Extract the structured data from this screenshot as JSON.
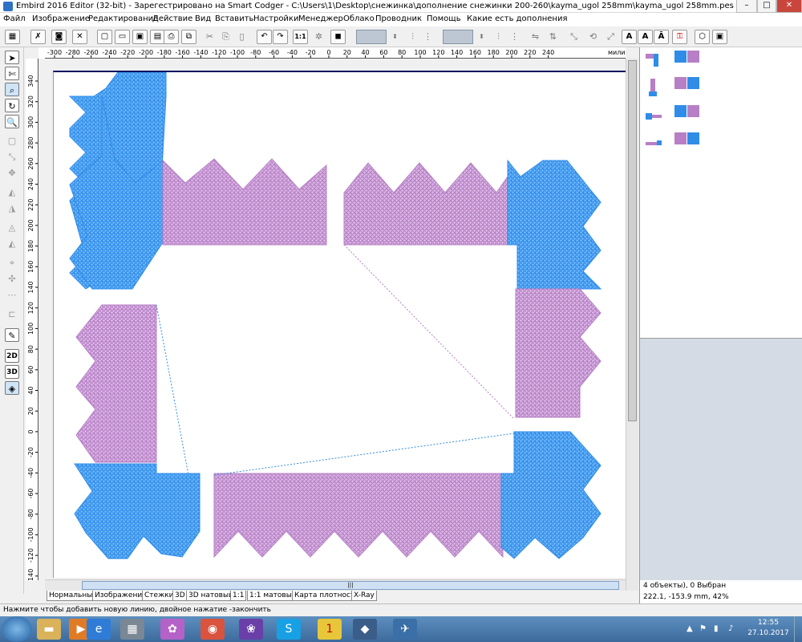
{
  "title": "Embird 2016 Editor (32-bit) - Зарегестрировано на Smart Codger - C:\\Users\\1\\Desktop\\снежинка\\дополнение снежинки 200-260\\kayma_ugol 258mm\\kayma_ugol 258mm.pes",
  "window_controls": {
    "minimize": "–",
    "maximize": "□",
    "close": "✕"
  },
  "menu": [
    "Файл",
    "Изображение",
    "Редактирование",
    "Действие",
    "Вид",
    "Вставить",
    "Настройки",
    "Менеджер",
    "Облако",
    "Проводник",
    "Помощь",
    "Какие есть дополнения"
  ],
  "ruler": {
    "top_ticks": [
      "-300",
      "-280",
      "-260",
      "-240",
      "-220",
      "-200",
      "-180",
      "-160",
      "-140",
      "-120",
      "-100",
      "-80",
      "-60",
      "-40",
      "-20",
      "0",
      "20",
      "40",
      "60",
      "80",
      "100",
      "120",
      "140",
      "160",
      "180",
      "200",
      "220",
      "240"
    ],
    "unit": "милиме",
    "left_ticks": [
      "340",
      "320",
      "300",
      "280",
      "260",
      "240",
      "220",
      "200",
      "180",
      "160",
      "140",
      "120",
      "100",
      "80",
      "60",
      "40",
      "20",
      "0",
      "-20",
      "-40",
      "-60",
      "-80",
      "-100",
      "-120",
      "-140",
      "-160"
    ]
  },
  "toolbar_text": {
    "ratio": "1:1"
  },
  "left_toolbar_text": {
    "text_2d": "2D",
    "text_3d": "3D"
  },
  "tabs": [
    "Нормальный",
    "Изображение",
    "Стежки",
    "3D",
    "3D натовый",
    "1:1",
    "1:1 матовый",
    "Карта плотности",
    "X-Ray"
  ],
  "status_hint": "Нажмите чтобы добавить новую линию, двойное нажатие -закончить",
  "panel_info": {
    "objects": "4 объекты), 0 Выбран",
    "coords": "222.1, -153.9 mm, 42%"
  },
  "colors": {
    "blue": "#2f8de8",
    "purple": "#b77fc6"
  },
  "scroll_grip": "|||",
  "taskbar": {
    "icons": [
      "folder-icon",
      "media-player-icon",
      "ie-icon",
      "file-manager-icon",
      "flower-icon",
      "chrome-icon",
      "pansy-icon",
      "skype-icon",
      "1c-icon",
      "embird-icon",
      "bird-icon"
    ],
    "time": "12:55",
    "date": "27.10.2017"
  }
}
